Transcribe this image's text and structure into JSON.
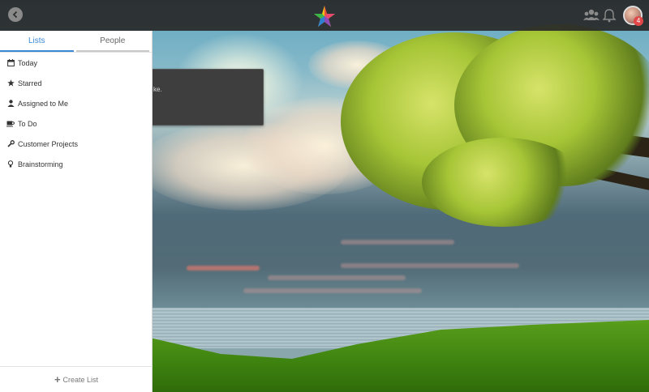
{
  "topbar": {
    "back_icon": "chevron-left-icon",
    "logo_icon": "rainbow-star-icon",
    "people_icon": "people-icon",
    "bell_icon": "bell-icon",
    "avatar_badge": "4"
  },
  "sidebar": {
    "tabs": [
      {
        "label": "Lists",
        "active": true
      },
      {
        "label": "People",
        "active": false
      }
    ],
    "items": [
      {
        "label": "Today",
        "icon": "calendar-icon"
      },
      {
        "label": "Starred",
        "icon": "star-icon"
      },
      {
        "label": "Assigned to Me",
        "icon": "user-icon"
      },
      {
        "label": "To Do",
        "icon": "coffee-icon"
      },
      {
        "label": "Customer Projects",
        "icon": "wrench-icon"
      },
      {
        "label": "Brainstorming",
        "icon": "lightbulb-icon"
      }
    ],
    "create_list_label": "Create List"
  },
  "toast": {
    "text_fragment": "ke."
  },
  "colors": {
    "accent": "#3a8ad6",
    "topbar_bg": "#282828",
    "badge": "#e24848"
  }
}
